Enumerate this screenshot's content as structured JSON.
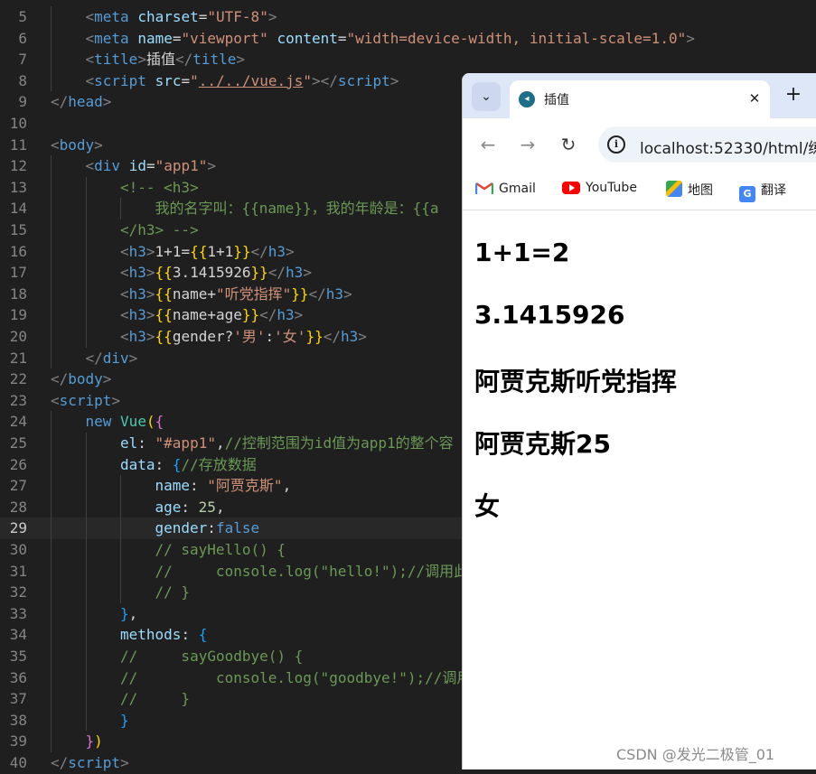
{
  "editor": {
    "active_line": 29,
    "lines": [
      {
        "n": 5,
        "indent": 1,
        "tokens": [
          [
            "t-punct",
            "<"
          ],
          [
            "t-tag",
            "meta"
          ],
          [
            "t-text",
            " "
          ],
          [
            "t-attr",
            "charset"
          ],
          [
            "t-text",
            "="
          ],
          [
            "t-str",
            "\"UTF-8\""
          ],
          [
            "t-punct",
            ">"
          ]
        ]
      },
      {
        "n": 6,
        "indent": 1,
        "tokens": [
          [
            "t-punct",
            "<"
          ],
          [
            "t-tag",
            "meta"
          ],
          [
            "t-text",
            " "
          ],
          [
            "t-attr",
            "name"
          ],
          [
            "t-text",
            "="
          ],
          [
            "t-str",
            "\"viewport\""
          ],
          [
            "t-text",
            " "
          ],
          [
            "t-attr",
            "content"
          ],
          [
            "t-text",
            "="
          ],
          [
            "t-str",
            "\"width=device-width, initial-scale=1.0\""
          ],
          [
            "t-punct",
            ">"
          ]
        ]
      },
      {
        "n": 7,
        "indent": 1,
        "tokens": [
          [
            "t-punct",
            "<"
          ],
          [
            "t-tag",
            "title"
          ],
          [
            "t-punct",
            ">"
          ],
          [
            "t-text",
            "插值"
          ],
          [
            "t-punct",
            "</"
          ],
          [
            "t-tag",
            "title"
          ],
          [
            "t-punct",
            ">"
          ]
        ]
      },
      {
        "n": 8,
        "indent": 1,
        "tokens": [
          [
            "t-punct",
            "<"
          ],
          [
            "t-tag",
            "script"
          ],
          [
            "t-text",
            " "
          ],
          [
            "t-attr",
            "src"
          ],
          [
            "t-text",
            "="
          ],
          [
            "t-str",
            "\""
          ],
          [
            "t-str t-link",
            "../../vue.js"
          ],
          [
            "t-str",
            "\""
          ],
          [
            "t-punct",
            "></"
          ],
          [
            "t-tag",
            "script"
          ],
          [
            "t-punct",
            ">"
          ]
        ]
      },
      {
        "n": 9,
        "indent": 0,
        "tokens": [
          [
            "t-punct",
            "</"
          ],
          [
            "t-tag",
            "head"
          ],
          [
            "t-punct",
            ">"
          ]
        ]
      },
      {
        "n": 10,
        "indent": 0,
        "tokens": []
      },
      {
        "n": 11,
        "indent": 0,
        "tokens": [
          [
            "t-punct",
            "<"
          ],
          [
            "t-tag",
            "body"
          ],
          [
            "t-punct",
            ">"
          ]
        ]
      },
      {
        "n": 12,
        "indent": 1,
        "tokens": [
          [
            "t-punct",
            "<"
          ],
          [
            "t-tag",
            "div"
          ],
          [
            "t-text",
            " "
          ],
          [
            "t-attr",
            "id"
          ],
          [
            "t-text",
            "="
          ],
          [
            "t-str",
            "\"app1\""
          ],
          [
            "t-punct",
            ">"
          ]
        ]
      },
      {
        "n": 13,
        "indent": 2,
        "tokens": [
          [
            "t-comment",
            "<!-- <h3>"
          ]
        ]
      },
      {
        "n": 14,
        "indent": 3,
        "tokens": [
          [
            "t-comment",
            "我的名字叫：{{name}}，我的年龄是：{{a"
          ]
        ]
      },
      {
        "n": 15,
        "indent": 2,
        "tokens": [
          [
            "t-comment",
            "</h3> -->"
          ]
        ]
      },
      {
        "n": 16,
        "indent": 2,
        "tokens": [
          [
            "t-punct",
            "<"
          ],
          [
            "t-tag",
            "h3"
          ],
          [
            "t-punct",
            ">"
          ],
          [
            "t-text",
            "1+1="
          ],
          [
            "t-brace",
            "{{"
          ],
          [
            "t-text",
            "1+1"
          ],
          [
            "t-brace",
            "}}"
          ],
          [
            "t-punct",
            "</"
          ],
          [
            "t-tag",
            "h3"
          ],
          [
            "t-punct",
            ">"
          ]
        ]
      },
      {
        "n": 17,
        "indent": 2,
        "tokens": [
          [
            "t-punct",
            "<"
          ],
          [
            "t-tag",
            "h3"
          ],
          [
            "t-punct",
            ">"
          ],
          [
            "t-brace",
            "{{"
          ],
          [
            "t-text",
            "3.1415926"
          ],
          [
            "t-brace",
            "}}"
          ],
          [
            "t-punct",
            "</"
          ],
          [
            "t-tag",
            "h3"
          ],
          [
            "t-punct",
            ">"
          ]
        ]
      },
      {
        "n": 18,
        "indent": 2,
        "tokens": [
          [
            "t-punct",
            "<"
          ],
          [
            "t-tag",
            "h3"
          ],
          [
            "t-punct",
            ">"
          ],
          [
            "t-brace",
            "{{"
          ],
          [
            "t-text",
            "name+"
          ],
          [
            "t-str",
            "\"听党指挥\""
          ],
          [
            "t-brace",
            "}}"
          ],
          [
            "t-punct",
            "</"
          ],
          [
            "t-tag",
            "h3"
          ],
          [
            "t-punct",
            ">"
          ]
        ]
      },
      {
        "n": 19,
        "indent": 2,
        "tokens": [
          [
            "t-punct",
            "<"
          ],
          [
            "t-tag",
            "h3"
          ],
          [
            "t-punct",
            ">"
          ],
          [
            "t-brace",
            "{{"
          ],
          [
            "t-text",
            "name+age"
          ],
          [
            "t-brace",
            "}}"
          ],
          [
            "t-punct",
            "</"
          ],
          [
            "t-tag",
            "h3"
          ],
          [
            "t-punct",
            ">"
          ]
        ]
      },
      {
        "n": 20,
        "indent": 2,
        "tokens": [
          [
            "t-punct",
            "<"
          ],
          [
            "t-tag",
            "h3"
          ],
          [
            "t-punct",
            ">"
          ],
          [
            "t-brace",
            "{{"
          ],
          [
            "t-text",
            "gender?"
          ],
          [
            "t-str",
            "'男'"
          ],
          [
            "t-text",
            ":"
          ],
          [
            "t-str",
            "'女'"
          ],
          [
            "t-brace",
            "}}"
          ],
          [
            "t-punct",
            "</"
          ],
          [
            "t-tag",
            "h3"
          ],
          [
            "t-punct",
            ">"
          ]
        ]
      },
      {
        "n": 21,
        "indent": 1,
        "tokens": [
          [
            "t-punct",
            "</"
          ],
          [
            "t-tag",
            "div"
          ],
          [
            "t-punct",
            ">"
          ]
        ]
      },
      {
        "n": 22,
        "indent": 0,
        "tokens": [
          [
            "t-punct",
            "</"
          ],
          [
            "t-tag",
            "body"
          ],
          [
            "t-punct",
            ">"
          ]
        ]
      },
      {
        "n": 23,
        "indent": 0,
        "tokens": [
          [
            "t-punct",
            "<"
          ],
          [
            "t-tag",
            "script"
          ],
          [
            "t-punct",
            ">"
          ]
        ]
      },
      {
        "n": 24,
        "indent": 1,
        "tokens": [
          [
            "t-tag",
            "new"
          ],
          [
            "t-text",
            " "
          ],
          [
            "t-fn",
            "Vue"
          ],
          [
            "t-brace",
            "("
          ],
          [
            "t-bracket2",
            "{"
          ]
        ]
      },
      {
        "n": 25,
        "indent": 2,
        "tokens": [
          [
            "t-key",
            "el"
          ],
          [
            "t-text",
            ": "
          ],
          [
            "t-str",
            "\"#app1\""
          ],
          [
            "t-text",
            ","
          ],
          [
            "t-comment",
            "//控制范围为id值为app1的整个容"
          ]
        ]
      },
      {
        "n": 26,
        "indent": 2,
        "tokens": [
          [
            "t-key",
            "data"
          ],
          [
            "t-text",
            ": "
          ],
          [
            "t-bracket3",
            "{"
          ],
          [
            "t-comment",
            "//存放数据"
          ]
        ]
      },
      {
        "n": 27,
        "indent": 3,
        "tokens": [
          [
            "t-key",
            "name"
          ],
          [
            "t-text",
            ": "
          ],
          [
            "t-str",
            "\"阿贾克斯\""
          ],
          [
            "t-text",
            ","
          ]
        ]
      },
      {
        "n": 28,
        "indent": 3,
        "tokens": [
          [
            "t-key",
            "age"
          ],
          [
            "t-text",
            ": "
          ],
          [
            "t-num",
            "25"
          ],
          [
            "t-text",
            ","
          ]
        ]
      },
      {
        "n": 29,
        "indent": 3,
        "tokens": [
          [
            "t-key",
            "gender"
          ],
          [
            "t-text",
            ":"
          ],
          [
            "t-bool",
            "false"
          ]
        ]
      },
      {
        "n": 30,
        "indent": 3,
        "tokens": [
          [
            "t-comment",
            "// sayHello() {"
          ]
        ]
      },
      {
        "n": 31,
        "indent": 3,
        "tokens": [
          [
            "t-comment",
            "//     console.log(\"hello!\");//调用此"
          ]
        ]
      },
      {
        "n": 32,
        "indent": 3,
        "tokens": [
          [
            "t-comment",
            "// }"
          ]
        ]
      },
      {
        "n": 33,
        "indent": 2,
        "tokens": [
          [
            "t-bracket3",
            "}"
          ],
          [
            "t-text",
            ","
          ]
        ]
      },
      {
        "n": 34,
        "indent": 2,
        "tokens": [
          [
            "t-key",
            "methods"
          ],
          [
            "t-text",
            ": "
          ],
          [
            "t-bracket3",
            "{"
          ]
        ]
      },
      {
        "n": 35,
        "indent": 2,
        "tokens": [
          [
            "t-comment",
            "//     sayGoodbye() {"
          ]
        ]
      },
      {
        "n": 36,
        "indent": 2,
        "tokens": [
          [
            "t-comment",
            "//         console.log(\"goodbye!\");//调用"
          ]
        ]
      },
      {
        "n": 37,
        "indent": 2,
        "tokens": [
          [
            "t-comment",
            "//     }"
          ]
        ]
      },
      {
        "n": 38,
        "indent": 2,
        "tokens": [
          [
            "t-bracket3",
            "}"
          ]
        ]
      },
      {
        "n": 39,
        "indent": 1,
        "tokens": [
          [
            "t-bracket2",
            "}"
          ],
          [
            "t-brace",
            ")"
          ]
        ]
      },
      {
        "n": 40,
        "indent": 0,
        "tokens": [
          [
            "t-punct",
            "</"
          ],
          [
            "t-tag",
            "script"
          ],
          [
            "t-punct",
            ">"
          ]
        ]
      }
    ]
  },
  "browser": {
    "tab_title": "插值",
    "url": "localhost:52330/html/练",
    "bookmarks": [
      {
        "label": "Gmail",
        "icon": "gmail-icon"
      },
      {
        "label": "YouTube",
        "icon": "youtube-icon"
      },
      {
        "label": "地图",
        "icon": "maps-icon"
      },
      {
        "label": "翻译",
        "icon": "translate-icon"
      }
    ],
    "output": [
      "1+1=2",
      "3.1415926",
      "阿贾克斯听党指挥",
      "阿贾克斯25",
      "女"
    ]
  },
  "watermark": "CSDN @发光二极管_01"
}
